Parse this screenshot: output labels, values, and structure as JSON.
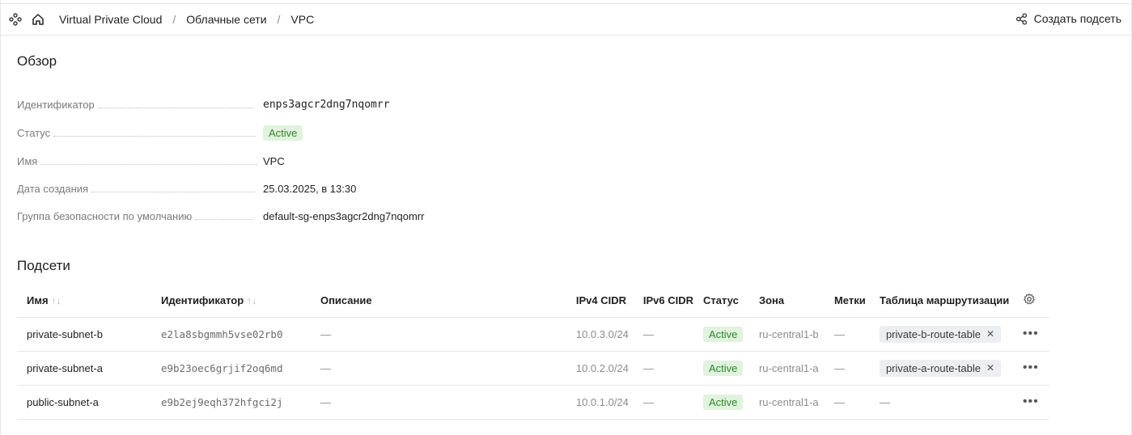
{
  "breadcrumbs": [
    "Virtual Private Cloud",
    "Облачные сети",
    "VPC"
  ],
  "actions": {
    "create_subnet": "Создать подсеть"
  },
  "overview": {
    "title": "Обзор",
    "fields": [
      {
        "key": "Идентификатор",
        "value": "enps3agcr2dng7nqomrr"
      },
      {
        "key": "Статус",
        "value": "Active"
      },
      {
        "key": "Имя",
        "value": "VPC"
      },
      {
        "key": "Дата создания",
        "value": "25.03.2025, в 13:30"
      },
      {
        "key": "Группа безопасности по умолчанию",
        "value": "default-sg-enps3agcr2dng7nqomrr"
      }
    ]
  },
  "subnets": {
    "title": "Подсети",
    "columns": [
      "Имя",
      "Идентификатор",
      "Описание",
      "IPv4 CIDR",
      "IPv6 CIDR",
      "Статус",
      "Зона",
      "Метки",
      "Таблица маршрутизации"
    ],
    "rows": [
      {
        "name": "private-subnet-b",
        "id": "e2la8sbgmmh5vse02rb0",
        "description": "—",
        "ipv4": "10.0.3.0/24",
        "ipv6": "—",
        "status": "Active",
        "zone": "ru-central1-b",
        "labels": "—",
        "route_table": "private-b-route-table"
      },
      {
        "name": "private-subnet-a",
        "id": "e9b23oec6grjif2oq6md",
        "description": "—",
        "ipv4": "10.0.2.0/24",
        "ipv6": "—",
        "status": "Active",
        "zone": "ru-central1-a",
        "labels": "—",
        "route_table": "private-a-route-table"
      },
      {
        "name": "public-subnet-a",
        "id": "e9b2ej9eqh372hfgci2j",
        "description": "—",
        "ipv4": "10.0.1.0/24",
        "ipv6": "—",
        "status": "Active",
        "zone": "ru-central1-a",
        "labels": "—",
        "route_table": "—"
      }
    ]
  },
  "colors": {
    "accent_link": "#2f6dd0",
    "status_bg": "#e1f2de",
    "status_text": "#2c8a2a"
  }
}
